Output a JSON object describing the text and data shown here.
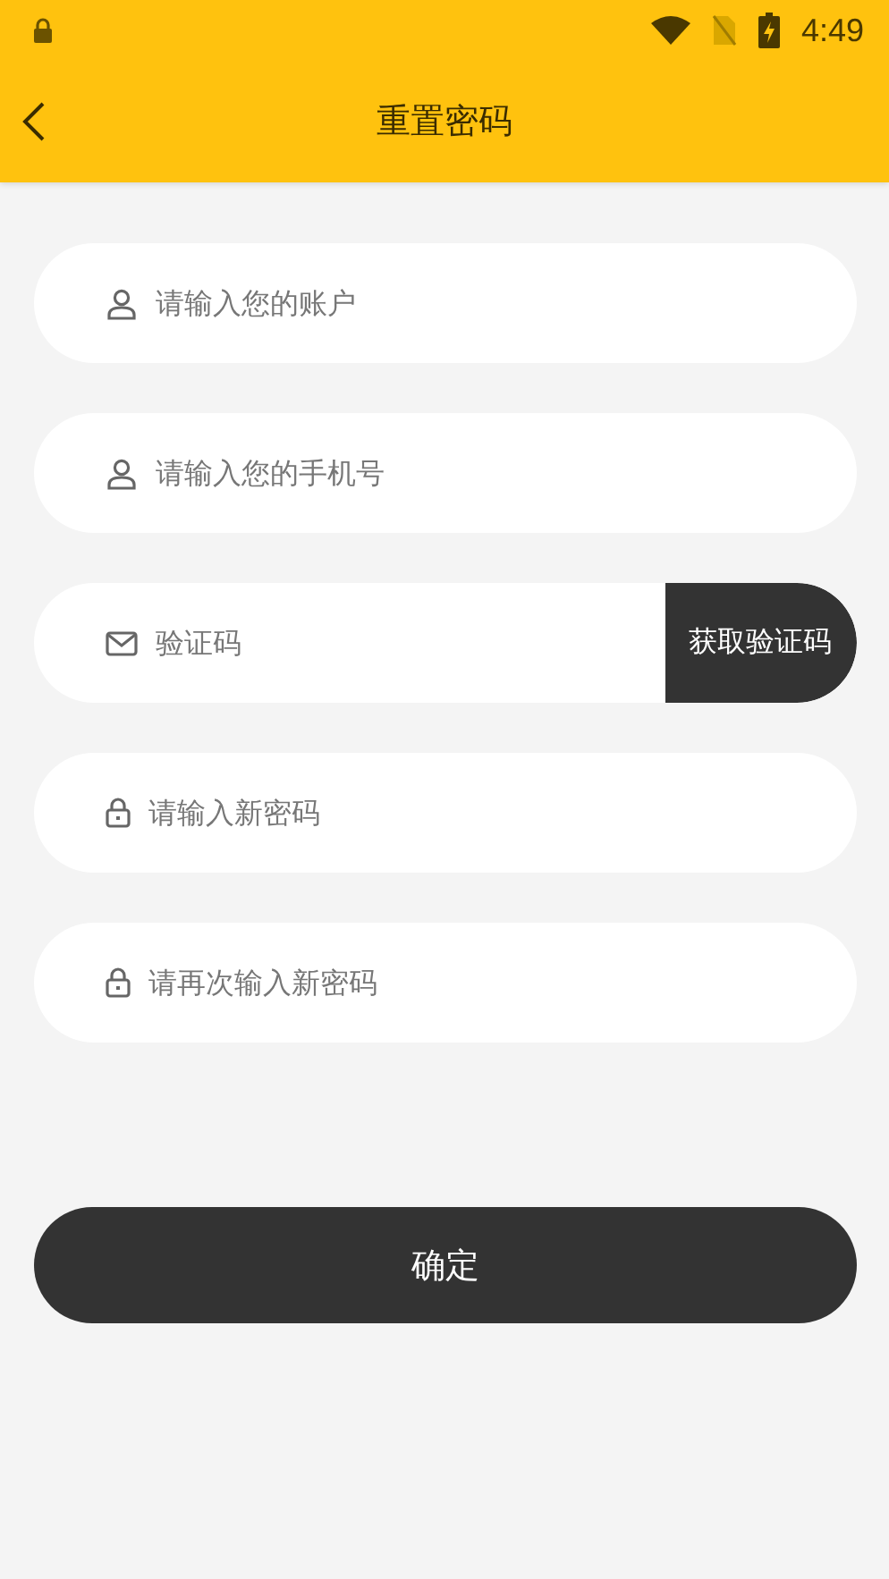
{
  "status_bar": {
    "time": "4:49"
  },
  "header": {
    "title": "重置密码"
  },
  "fields": [
    {
      "kind": "account",
      "placeholder": "请输入您的账户"
    },
    {
      "kind": "phone",
      "placeholder": "请输入您的手机号"
    },
    {
      "kind": "code",
      "placeholder": "验证码",
      "button": "获取验证码"
    },
    {
      "kind": "password",
      "placeholder": "请输入新密码"
    },
    {
      "kind": "password",
      "placeholder": "请再次输入新密码"
    }
  ],
  "submit": "确定"
}
